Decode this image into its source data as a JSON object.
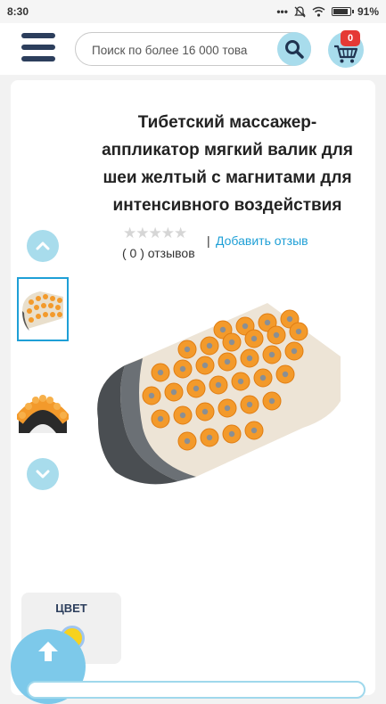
{
  "status": {
    "time": "8:30",
    "battery": "91%",
    "battery_level": 0.91
  },
  "header": {
    "search_placeholder": "Поиск по более 16 000 това",
    "cart_count": "0"
  },
  "product": {
    "title": "Тибетский массажер-аппликатор мягкий валик для шеи желтый с магнитами для интенсивного воздействия",
    "rating_stars": "★★★★★",
    "rating_value": 0,
    "reviews_count": "( 0 ) отзывов",
    "separator": "|",
    "add_review": "Добавить отзыв"
  },
  "options": {
    "color_label": "ЦВЕТ",
    "selected_color": "#f7d21f"
  },
  "colors": {
    "accent": "#1e9fd6",
    "light_blue": "#a8dcec",
    "badge": "#e53935",
    "navy": "#2c3e5c"
  }
}
